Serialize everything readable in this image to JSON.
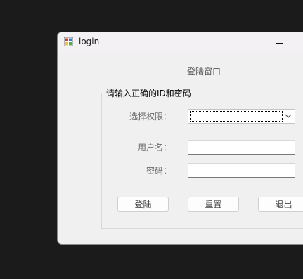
{
  "window": {
    "title": "login",
    "app_icon": "app-icon"
  },
  "form": {
    "title": "登陆窗口",
    "group_label": "请输入正确的ID和密码",
    "permission_label": "选择权限：",
    "permission_value": "",
    "username_label": "用户名：",
    "username_value": "",
    "password_label": "密码：",
    "password_value": ""
  },
  "buttons": {
    "login": "登陆",
    "reset": "重置",
    "exit": "退出"
  },
  "icons": {
    "minimize": "minimize-icon",
    "dropdown": "chevron-down-icon"
  }
}
